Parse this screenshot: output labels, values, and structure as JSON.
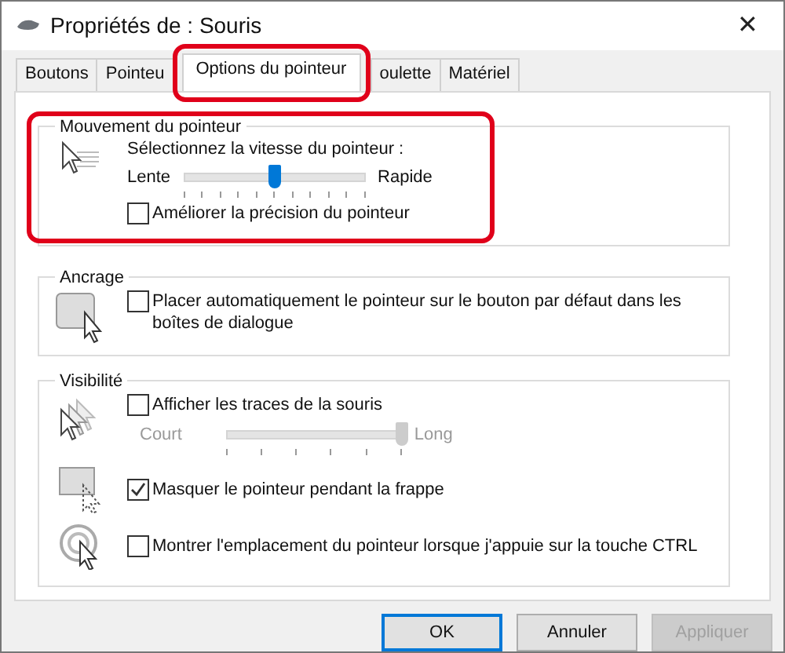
{
  "window": {
    "title": "Propriétés de : Souris",
    "close": "✕"
  },
  "tabs": [
    {
      "label": "Boutons",
      "selected": false,
      "annotated": false
    },
    {
      "label": "Pointeu",
      "selected": false,
      "annotated": false
    },
    {
      "label": "Options du pointeur",
      "selected": true,
      "annotated": true
    },
    {
      "label": "oulette",
      "selected": false,
      "annotated": false
    },
    {
      "label": "Matériel",
      "selected": false,
      "annotated": false
    }
  ],
  "motion": {
    "title": "Mouvement du pointeur",
    "annotated": true,
    "prompt": "Sélectionnez la vitesse du pointeur :",
    "slow": "Lente",
    "fast": "Rapide",
    "level": 0.5,
    "precision": {
      "label": "Améliorer la précision du pointeur",
      "checked": false
    }
  },
  "snap": {
    "title": "Ancrage",
    "option": {
      "label": "Placer automatiquement le pointeur sur le bouton par défaut dans les boîtes de dialogue",
      "checked": false
    }
  },
  "visibility": {
    "title": "Visibilité",
    "trails": {
      "label": "Afficher les traces de la souris",
      "checked": false
    },
    "trail_slider": {
      "short": "Court",
      "long": "Long",
      "level": 1,
      "disabled": true
    },
    "hide": {
      "label": "Masquer le pointeur pendant la frappe",
      "checked": true
    },
    "ctrl": {
      "label": "Montrer l'emplacement du pointeur lorsque j'appuie sur la touche CTRL",
      "checked": false
    }
  },
  "buttons": [
    {
      "label": "OK",
      "kind": "default"
    },
    {
      "label": "Annuler",
      "kind": "normal"
    },
    {
      "label": "Appliquer",
      "kind": "disabled"
    }
  ]
}
